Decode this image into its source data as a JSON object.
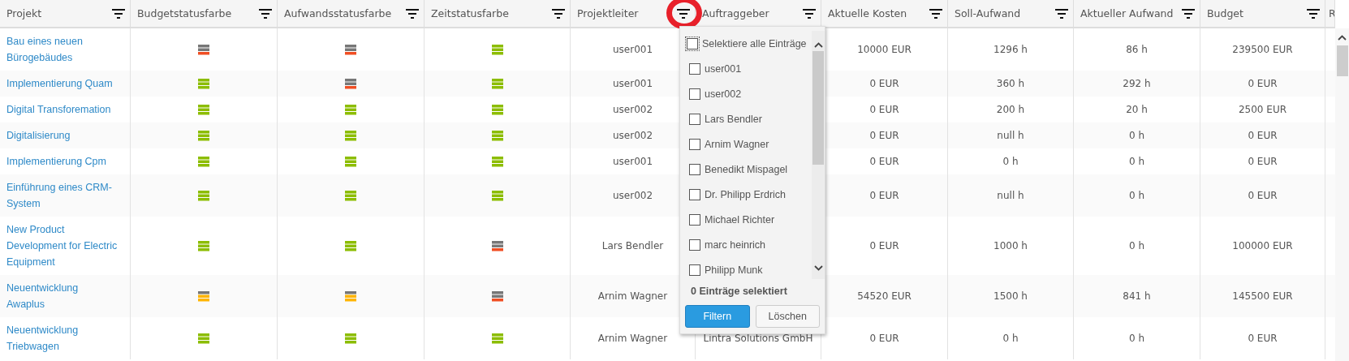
{
  "table": {
    "columns": [
      {
        "label": "Projekt",
        "kind": "link",
        "filter": true,
        "highlighted": false
      },
      {
        "label": "Budgetstatusfarbe",
        "kind": "status",
        "filter": true,
        "highlighted": false
      },
      {
        "label": "Aufwandsstatusfarbe",
        "kind": "status",
        "filter": true,
        "highlighted": false
      },
      {
        "label": "Zeitstatusfarbe",
        "kind": "status",
        "filter": true,
        "highlighted": false
      },
      {
        "label": "Projektleiter",
        "kind": "text",
        "filter": true,
        "highlighted": true
      },
      {
        "label": "Auftraggeber",
        "kind": "text",
        "filter": true,
        "highlighted": false
      },
      {
        "label": "Aktuelle Kosten",
        "kind": "text",
        "filter": true,
        "highlighted": false
      },
      {
        "label": "Soll-Aufwand",
        "kind": "text",
        "filter": true,
        "highlighted": false
      },
      {
        "label": "Aktueller Aufwand",
        "kind": "text",
        "filter": true,
        "highlighted": false
      },
      {
        "label": "Budget",
        "kind": "text",
        "filter": true,
        "highlighted": false
      },
      {
        "label": "R",
        "kind": "text",
        "filter": false,
        "highlighted": false
      }
    ],
    "rows": [
      {
        "projekt": "Bau eines neuen Bürogebäudes",
        "budgetstatus": {
          "color": "#f04e23"
        },
        "aufwandsstatus": {
          "color": "#f04e23"
        },
        "zeitstatus": {
          "color": "#8cbd00"
        },
        "projektleiter": "user001",
        "aktuelle_kosten": "10000 EUR",
        "soll_aufwand": "1296 h",
        "aktueller_aufwand": "86 h",
        "budget": "239500 EUR"
      },
      {
        "projekt": "Implementierung Quam",
        "budgetstatus": {
          "color": "#8cbd00"
        },
        "aufwandsstatus": {
          "color": "#f04e23"
        },
        "zeitstatus": {
          "color": "#8cbd00"
        },
        "projektleiter": "user001",
        "aktuelle_kosten": "0 EUR",
        "soll_aufwand": "360 h",
        "aktueller_aufwand": "292 h",
        "budget": "0 EUR"
      },
      {
        "projekt": "Digital Transforemation",
        "budgetstatus": {
          "color": "#8cbd00"
        },
        "aufwandsstatus": {
          "color": "#8cbd00"
        },
        "zeitstatus": {
          "color": "#8cbd00"
        },
        "projektleiter": "user002",
        "aktuelle_kosten": "0 EUR",
        "soll_aufwand": "200 h",
        "aktueller_aufwand": "20 h",
        "budget": "2500 EUR"
      },
      {
        "projekt": "Digitalisierung",
        "budgetstatus": {
          "color": "#8cbd00"
        },
        "aufwandsstatus": {
          "color": "#8cbd00"
        },
        "zeitstatus": {
          "color": "#8cbd00"
        },
        "projektleiter": "user002",
        "aktuelle_kosten": "0 EUR",
        "soll_aufwand": "null h",
        "aktueller_aufwand": "0 h",
        "budget": "0 EUR"
      },
      {
        "projekt": "Implementierung Cpm",
        "budgetstatus": {
          "color": "#8cbd00"
        },
        "aufwandsstatus": {
          "color": "#8cbd00"
        },
        "zeitstatus": {
          "color": "#8cbd00"
        },
        "projektleiter": "user001",
        "aktuelle_kosten": "0 EUR",
        "soll_aufwand": "0 h",
        "aktueller_aufwand": "0 h",
        "budget": "0 EUR"
      },
      {
        "projekt": "Einführung eines CRM-System",
        "budgetstatus": {
          "color": "#8cbd00"
        },
        "aufwandsstatus": {
          "color": "#8cbd00"
        },
        "zeitstatus": {
          "color": "#8cbd00"
        },
        "projektleiter": "user002",
        "aktuelle_kosten": "0 EUR",
        "soll_aufwand": "null h",
        "aktueller_aufwand": "0 h",
        "budget": "0 EUR"
      },
      {
        "projekt": "New Product Development for Electric Equipment",
        "budgetstatus": {
          "color": "#8cbd00"
        },
        "aufwandsstatus": {
          "color": "#8cbd00"
        },
        "zeitstatus": {
          "color": "#f04e23"
        },
        "projektleiter": "Lars Bendler",
        "aktuelle_kosten": "0 EUR",
        "soll_aufwand": "1000 h",
        "aktueller_aufwand": "0 h",
        "budget": "100000 EUR"
      },
      {
        "projekt": "Neuentwicklung Awaplus",
        "budgetstatus": {
          "color": "#ffb400"
        },
        "aufwandsstatus": {
          "color": "#ffb400"
        },
        "zeitstatus": {
          "color": "#f04e23"
        },
        "projektleiter": "Arnim Wagner",
        "aktuelle_kosten": "54520 EUR",
        "soll_aufwand": "1500 h",
        "aktueller_aufwand": "841 h",
        "budget": "145500 EUR"
      },
      {
        "projekt": "Neuentwicklung Triebwagen",
        "budgetstatus": {
          "color": "#8cbd00"
        },
        "aufwandsstatus": {
          "color": "#8cbd00"
        },
        "zeitstatus": {
          "color": "#8cbd00"
        },
        "projektleiter": "Arnim Wagner",
        "auftraggeber": "Lintra Solutions GmbH",
        "aktuelle_kosten": "0 EUR",
        "soll_aufwand": "0 h",
        "aktueller_aufwand": "0 h",
        "budget": "0 EUR"
      }
    ]
  },
  "filter_popup": {
    "select_all": {
      "label": "Selektiere alle Einträge",
      "checked": false,
      "focused": true
    },
    "options": [
      {
        "label": "user001",
        "checked": false
      },
      {
        "label": "user002",
        "checked": false
      },
      {
        "label": "Lars Bendler",
        "checked": false
      },
      {
        "label": "Arnim Wagner",
        "checked": false
      },
      {
        "label": "Benedikt Mispagel",
        "checked": false
      },
      {
        "label": "Dr. Philipp Erdrich",
        "checked": false
      },
      {
        "label": "Michael Richter",
        "checked": false
      },
      {
        "label": "marc heinrich",
        "checked": false
      },
      {
        "label": "Philipp Munk",
        "checked": false
      }
    ],
    "summary": "0 Einträge selektiert",
    "buttons": [
      {
        "label": "Filtern",
        "kind": "primary"
      },
      {
        "label": "Löschen",
        "kind": "secondary"
      }
    ]
  }
}
